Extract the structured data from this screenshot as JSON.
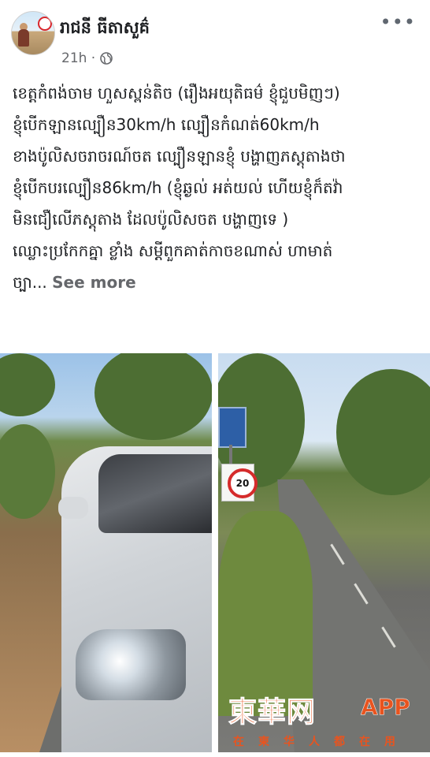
{
  "post": {
    "author": "រាជនី ធីតាសួគ៌",
    "time": "21h ·",
    "lines": [
      "ខេត្តកំពង់ចាម ហួសស្ពន់តិច (រឿងអយុតិធម៌ ខ្ញុំជួបមិញៗ)",
      "ខ្ញុំបើកឡានល្បឿន30km/h ល្បឿនកំណត់60km/h",
      "ខាងប៉ូលិសចរាចរណ៍ចត ល្បឿនឡានខ្ញុំ បង្ហាញភស្តុតាងថា",
      "ខ្ញុំបើកបរល្បឿន86km/h (ខ្ញុំឆ្ងល់ អត់យល់ ហើយខ្ញុំក៏តវ៉ា",
      "មិនជឿលើភស្តុតាង ដែលប៉ូលិសចត បង្ហាញទេ )",
      "ឈ្លោះប្រកែកគ្នា ខ្លាំង សម្ដីពួកគាត់កាចខណាស់ ហាមាត់"
    ],
    "last_line_prefix": "ច្បា...",
    "see_more": "See more",
    "more_menu": "•••"
  },
  "photos": {
    "speed_sign": "20"
  },
  "watermark": {
    "brand": "東華网",
    "app": "APP",
    "slogan": "在柬华人都在用"
  },
  "icons": {
    "globe": "globe-icon",
    "more": "more-horizontal-icon"
  },
  "colors": {
    "text": "#1c1e21",
    "meta": "#65676b",
    "watermark": "#e8541f"
  }
}
